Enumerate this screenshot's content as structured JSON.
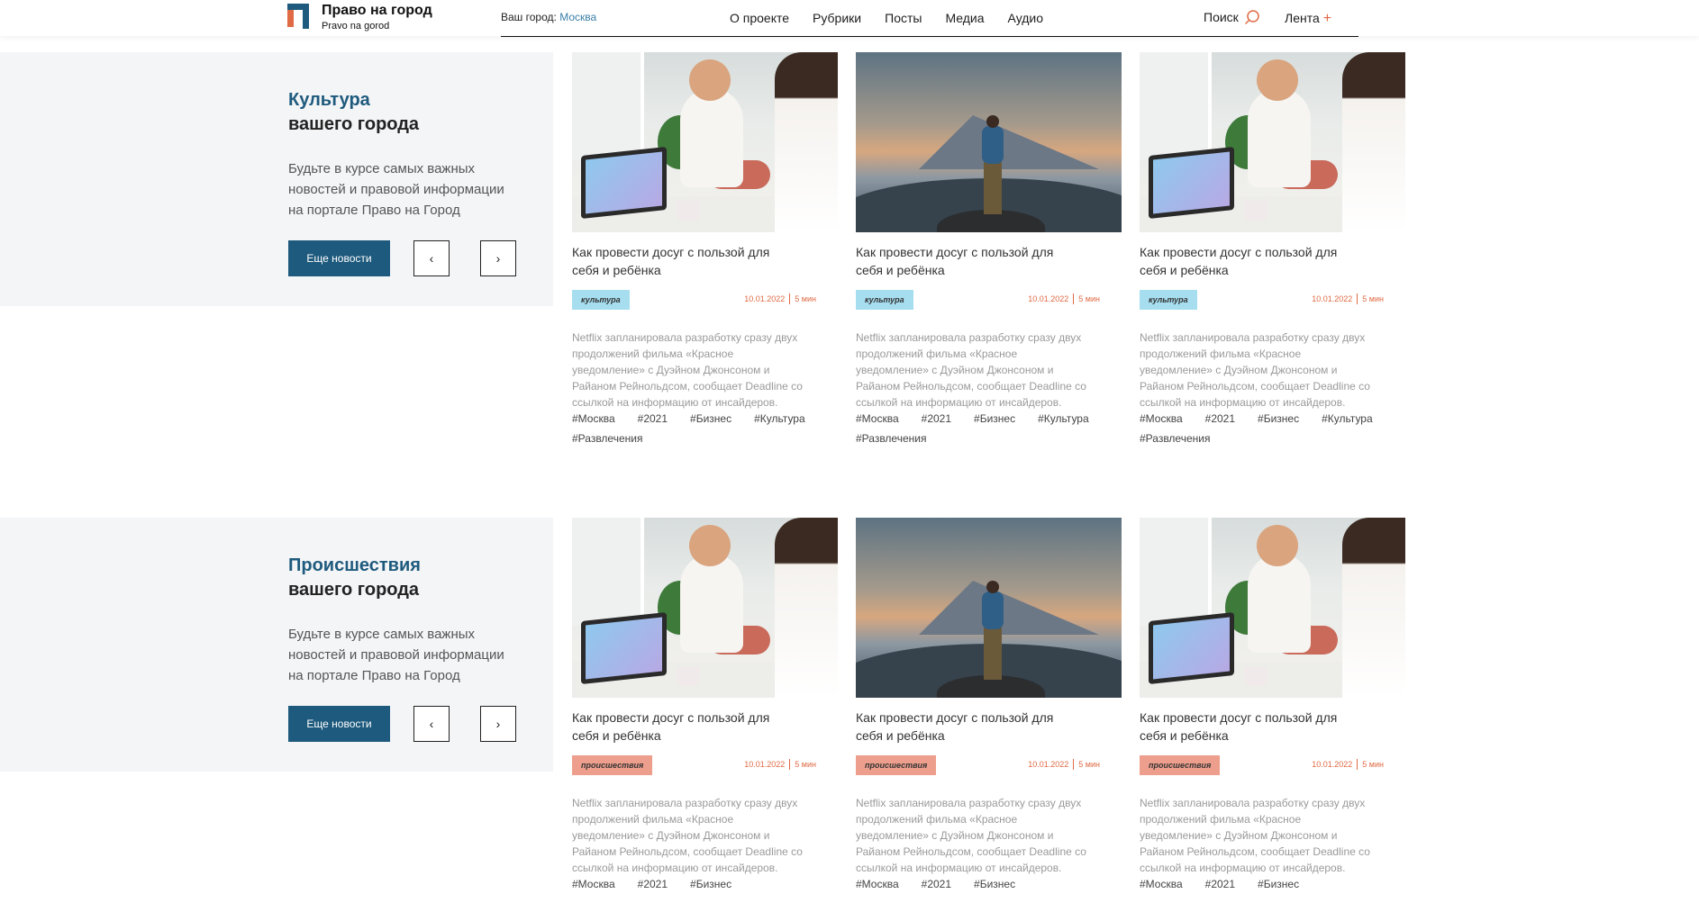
{
  "header": {
    "logo_title": "Право на город",
    "logo_subtitle": "Pravo na gorod",
    "city_label": "Ваш город:",
    "city_value": "Москва",
    "nav": [
      "О проекте",
      "Рубрики",
      "Посты",
      "Медиа",
      "Аудио"
    ],
    "search_label": "Поиск",
    "feed_label": "Лента",
    "feed_plus": "+"
  },
  "colors": {
    "brand_blue": "#1e5a7d",
    "accent_orange": "#e06a44",
    "tag_culture": "#a6def0",
    "tag_incident": "#ee9e8c"
  },
  "sections": [
    {
      "title_line1": "Культура",
      "title_line2": "вашего города",
      "description": "Будьте в курсе самых важных новостей и правовой информации на портале Право на Город",
      "more_label": "Еще новости",
      "prev_label": "‹",
      "next_label": "›",
      "cards": [
        {
          "image": "kid-tablet-photo",
          "title": "Как провести досуг с пользой для себя и ребёнка",
          "tag": "культура",
          "date": "10.01.2022",
          "read_time": "5 мин",
          "excerpt": "Netflix запланировала разработку сразу двух продолжений фильма «Красное уведомление» с Дуэйном Джонсоном и Райаном Рейнольдсом, сообщает Deadline со ссылкой на информацию от инсайдеров.",
          "hashtags": [
            "#Москва",
            "#2021",
            "#Бизнес",
            "#Культура",
            "#Развлечения"
          ]
        },
        {
          "image": "mountain-man-photo",
          "title": "Как провести досуг с пользой для себя и ребёнка",
          "tag": "культура",
          "date": "10.01.2022",
          "read_time": "5 мин",
          "excerpt": "Netflix запланировала разработку сразу двух продолжений фильма «Красное уведомление» с Дуэйном Джонсоном и Райаном Рейнольдсом, сообщает Deadline со ссылкой на информацию от инсайдеров.",
          "hashtags": [
            "#Москва",
            "#2021",
            "#Бизнес",
            "#Культура",
            "#Развлечения"
          ]
        },
        {
          "image": "kid-tablet-photo",
          "title": "Как провести досуг с пользой для себя и ребёнка",
          "tag": "культура",
          "date": "10.01.2022",
          "read_time": "5 мин",
          "excerpt": "Netflix запланировала разработку сразу двух продолжений фильма «Красное уведомление» с Дуэйном Джонсоном и Райаном Рейнольдсом, сообщает Deadline со ссылкой на информацию от инсайдеров.",
          "hashtags": [
            "#Москва",
            "#2021",
            "#Бизнес",
            "#Культура",
            "#Развлечения"
          ]
        }
      ]
    },
    {
      "title_line1": "Происшествия",
      "title_line2": "вашего города",
      "description": "Будьте в курсе самых важных новостей и правовой информации на портале Право на Город",
      "more_label": "Еще новости",
      "prev_label": "‹",
      "next_label": "›",
      "cards": [
        {
          "image": "kid-tablet-photo",
          "title": "Как провести досуг с пользой для себя и ребёнка",
          "tag": "происшествия",
          "date": "10.01.2022",
          "read_time": "5 мин",
          "excerpt": "Netflix запланировала разработку сразу двух продолжений фильма «Красное уведомление» с Дуэйном Джонсоном и Райаном Рейнольдсом, сообщает Deadline со ссылкой на информацию от инсайдеров.",
          "hashtags": [
            "#Москва",
            "#2021",
            "#Бизнес"
          ]
        },
        {
          "image": "mountain-man-photo",
          "title": "Как провести досуг с пользой для себя и ребёнка",
          "tag": "происшествия",
          "date": "10.01.2022",
          "read_time": "5 мин",
          "excerpt": "Netflix запланировала разработку сразу двух продолжений фильма «Красное уведомление» с Дуэйном Джонсоном и Райаном Рейнольдсом, сообщает Deadline со ссылкой на информацию от инсайдеров.",
          "hashtags": [
            "#Москва",
            "#2021",
            "#Бизнес"
          ]
        },
        {
          "image": "kid-tablet-photo",
          "title": "Как провести досуг с пользой для себя и ребёнка",
          "tag": "происшествия",
          "date": "10.01.2022",
          "read_time": "5 мин",
          "excerpt": "Netflix запланировала разработку сразу двух продолжений фильма «Красное уведомление» с Дуэйном Джонсоном и Райаном Рейнольдсом, сообщает Deadline со ссылкой на информацию от инсайдеров.",
          "hashtags": [
            "#Москва",
            "#2021",
            "#Бизнес"
          ]
        }
      ]
    }
  ]
}
